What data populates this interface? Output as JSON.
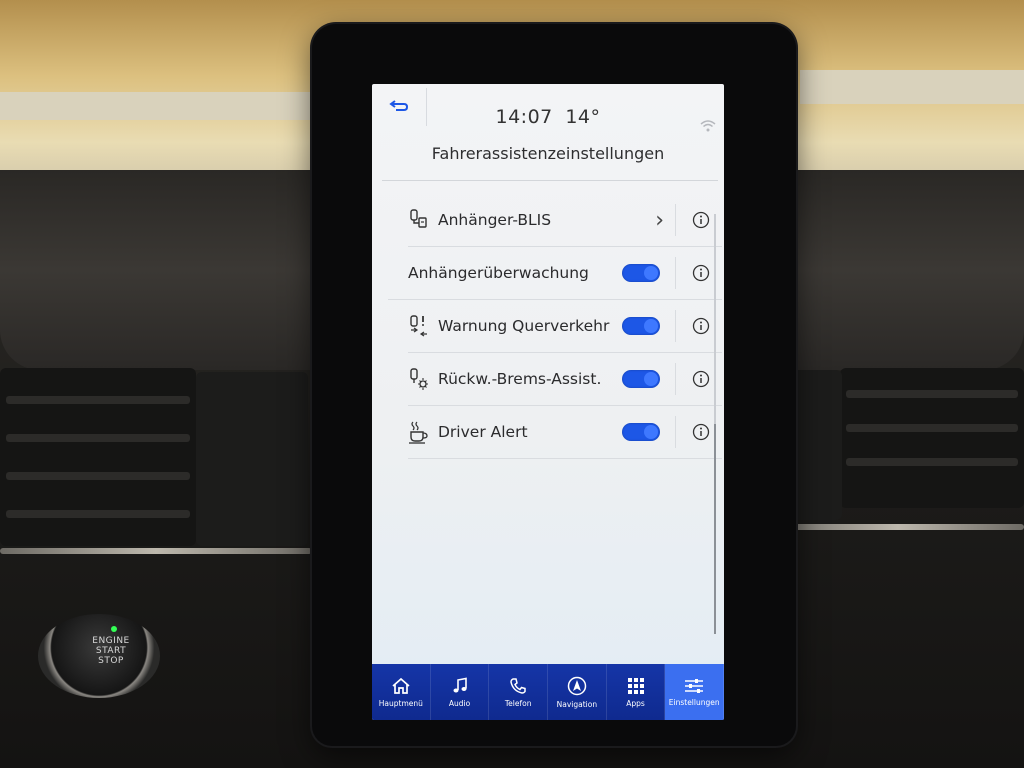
{
  "screen": {
    "clock": {
      "time": "14:07",
      "temperature": "14°"
    },
    "title": "Fahrerassistenzeinstellungen",
    "settings": [
      {
        "label": "Anhänger-BLIS",
        "control": "chevron",
        "icon": "trailer-blis-icon"
      },
      {
        "label": "Anhängerüberwachung",
        "control": "toggle",
        "enabled": true,
        "icon": null
      },
      {
        "label": "Warnung Querverkehr",
        "control": "toggle",
        "enabled": true,
        "icon": "cross-traffic-warning-icon"
      },
      {
        "label": "Rückw.-Brems-Assist.",
        "control": "toggle",
        "enabled": true,
        "icon": "reverse-brake-assist-icon"
      },
      {
        "label": "Driver Alert",
        "control": "toggle",
        "enabled": true,
        "icon": "coffee-cup-icon"
      }
    ],
    "nav": [
      {
        "label": "Hauptmenü",
        "icon": "home-icon",
        "active": false
      },
      {
        "label": "Audio",
        "icon": "music-note-icon",
        "active": false
      },
      {
        "label": "Telefon",
        "icon": "phone-icon",
        "active": false
      },
      {
        "label": "Navigation",
        "icon": "navigation-arrow-icon",
        "active": false
      },
      {
        "label": "Apps",
        "icon": "apps-grid-icon",
        "active": false
      },
      {
        "label": "Einstellungen",
        "icon": "settings-sliders-icon",
        "active": true
      }
    ]
  },
  "car": {
    "engine_button": {
      "line1": "ENGINE",
      "line2": "START",
      "line3": "STOP"
    }
  },
  "colors": {
    "nav_bar": "#1535a7",
    "nav_active": "#3b6ff0",
    "toggle_on": "#1d57e6"
  }
}
